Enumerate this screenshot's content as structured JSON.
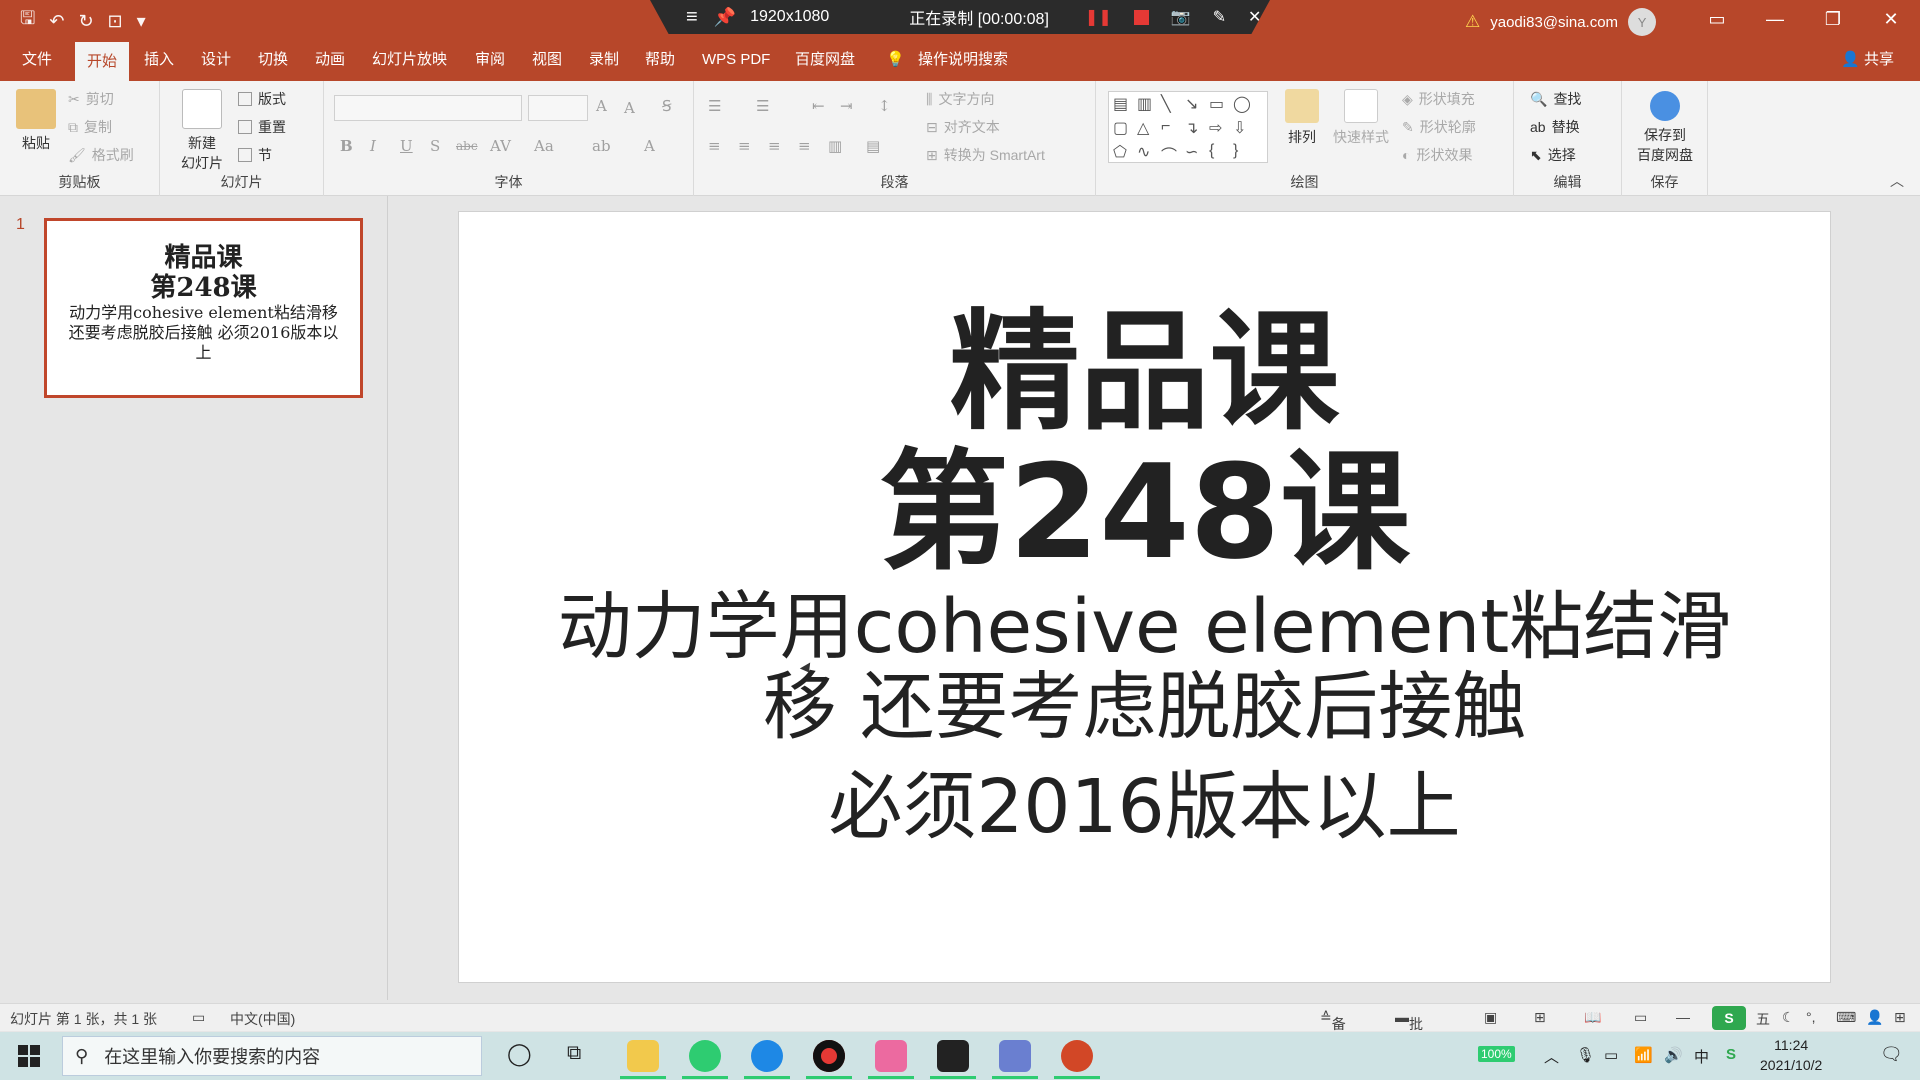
{
  "recorder": {
    "resolution": "1920x1080",
    "status": "正在录制 [00:00:08]"
  },
  "account": {
    "email": "yaodi83@sina.com",
    "avatar_initial": "Y"
  },
  "tabs": [
    "文件",
    "开始",
    "插入",
    "设计",
    "切换",
    "动画",
    "幻灯片放映",
    "审阅",
    "视图",
    "录制",
    "帮助",
    "WPS PDF",
    "百度网盘",
    "操作说明搜索"
  ],
  "share_label": "共享",
  "ribbon": {
    "clipboard": {
      "paste": "粘贴",
      "cut": "剪切",
      "copy": "复制",
      "format_painter": "格式刷",
      "label": "剪贴板"
    },
    "slides": {
      "new_slide_line1": "新建",
      "new_slide_line2": "幻灯片",
      "layout": "版式",
      "reset": "重置",
      "section": "节",
      "label": "幻灯片"
    },
    "font": {
      "label": "字体"
    },
    "paragraph": {
      "text_direction": "文字方向",
      "align_text": "对齐文本",
      "convert_smartart": "转换为 SmartArt",
      "label": "段落"
    },
    "drawing": {
      "arrange": "排列",
      "quick_styles": "快速样式",
      "shape_fill": "形状填充",
      "shape_outline": "形状轮廓",
      "shape_effects": "形状效果",
      "label": "绘图"
    },
    "editing": {
      "find": "查找",
      "replace": "替换",
      "select": "选择",
      "label": "编辑"
    },
    "save": {
      "line1": "保存到",
      "line2": "百度网盘",
      "label": "保存"
    }
  },
  "thumbnail": {
    "number": "1",
    "title1": "精品课",
    "title2": "第248课",
    "body": "动力学用cohesive element粘结滑移 还要考虑脱胶后接触 必须2016版本以上"
  },
  "slide": {
    "title1": "精品课",
    "title2": "第248课",
    "line1": "动力学用cohesive element粘结滑",
    "line2": "移 还要考虑脱胶后接触",
    "line3": "必须2016版本以上"
  },
  "statusbar": {
    "slide_info": "幻灯片 第 1 张，共 1 张",
    "language": "中文(中国)",
    "notes": "备注",
    "comments": "批注",
    "ime": "五"
  },
  "taskbar": {
    "search_placeholder": "在这里输入你要搜索的内容",
    "battery": "100%",
    "time": "11:24",
    "date": "2021/10/2"
  },
  "colors": {
    "accent": "#b7472a",
    "ribbon_bg": "#f3f3f3",
    "taskbar_bg": "#cfe3e4"
  }
}
